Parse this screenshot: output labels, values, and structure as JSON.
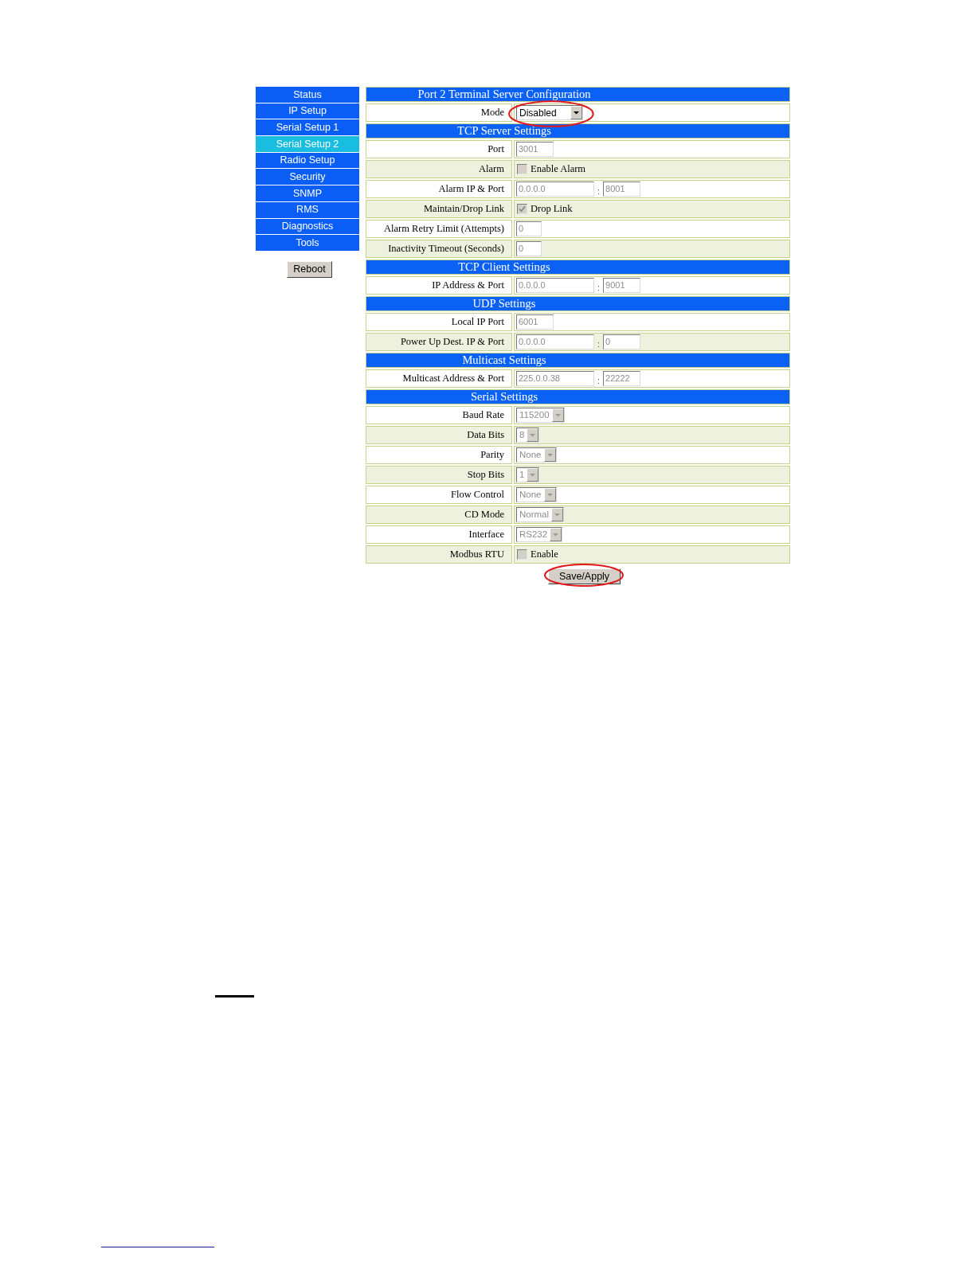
{
  "sidebar": {
    "items": [
      {
        "label": "Status",
        "selected": false
      },
      {
        "label": "IP Setup",
        "selected": false
      },
      {
        "label": "Serial Setup 1",
        "selected": false
      },
      {
        "label": "Serial Setup 2",
        "selected": true
      },
      {
        "label": "Radio Setup",
        "selected": false
      },
      {
        "label": "Security",
        "selected": false
      },
      {
        "label": "SNMP",
        "selected": false
      },
      {
        "label": "RMS",
        "selected": false
      },
      {
        "label": "Diagnostics",
        "selected": false
      },
      {
        "label": "Tools",
        "selected": false
      }
    ],
    "reboot_button": "Reboot"
  },
  "form": {
    "sections": [
      {
        "title": "Port 2 Terminal Server Configuration",
        "rows": [
          {
            "label": "Mode",
            "kind": "select",
            "value": "Disabled",
            "disabled": false,
            "annotated": true
          }
        ]
      },
      {
        "title": "TCP Server Settings",
        "rows": [
          {
            "label": "Port",
            "kind": "input",
            "value": "3001",
            "disabled": true
          },
          {
            "label": "Alarm",
            "kind": "checkbox",
            "option": "Enable Alarm",
            "checked": false,
            "disabled": true
          },
          {
            "label": "Alarm IP & Port",
            "kind": "input_pair",
            "address": "0.0.0.0",
            "separator": ":",
            "port": "8001",
            "disabled": true
          },
          {
            "label": "Maintain/Drop Link",
            "kind": "checkbox",
            "option": "Drop Link",
            "checked": true,
            "disabled": true
          },
          {
            "label": "Alarm Retry Limit (Attempts)",
            "kind": "input",
            "value": "0",
            "disabled": true
          },
          {
            "label": "Inactivity Timeout (Seconds)",
            "kind": "input",
            "value": "0",
            "disabled": true
          }
        ]
      },
      {
        "title": "TCP Client Settings",
        "rows": [
          {
            "label": "IP Address & Port",
            "kind": "input_pair",
            "address": "0.0.0.0",
            "separator": ":",
            "port": "9001",
            "disabled": true
          }
        ]
      },
      {
        "title": "UDP Settings",
        "rows": [
          {
            "label": "Local IP Port",
            "kind": "input",
            "value": "6001",
            "disabled": true
          },
          {
            "label": "Power Up Dest. IP & Port",
            "kind": "input_pair",
            "address": "0.0.0.0",
            "separator": ":",
            "port": "0",
            "disabled": true
          }
        ]
      },
      {
        "title": "Multicast Settings",
        "rows": [
          {
            "label": "Multicast Address & Port",
            "kind": "input_pair",
            "address": "225.0.0.38",
            "separator": ":",
            "port": "22222",
            "disabled": true
          }
        ]
      },
      {
        "title": "Serial Settings",
        "rows": [
          {
            "label": "Baud Rate",
            "kind": "select",
            "value": "115200",
            "disabled": true
          },
          {
            "label": "Data Bits",
            "kind": "select",
            "value": "8",
            "disabled": true
          },
          {
            "label": "Parity",
            "kind": "select",
            "value": "None",
            "disabled": true
          },
          {
            "label": "Stop Bits",
            "kind": "select",
            "value": "1",
            "disabled": true
          },
          {
            "label": "Flow Control",
            "kind": "select",
            "value": "None",
            "disabled": true
          },
          {
            "label": "CD Mode",
            "kind": "select",
            "value": "Normal",
            "disabled": true
          },
          {
            "label": "Interface",
            "kind": "select",
            "value": "RS232",
            "disabled": true
          },
          {
            "label": "Modbus RTU",
            "kind": "checkbox",
            "option": "Enable",
            "checked": false,
            "disabled": true
          }
        ]
      }
    ],
    "save_button": {
      "label": "Save/Apply",
      "annotated": true
    }
  }
}
